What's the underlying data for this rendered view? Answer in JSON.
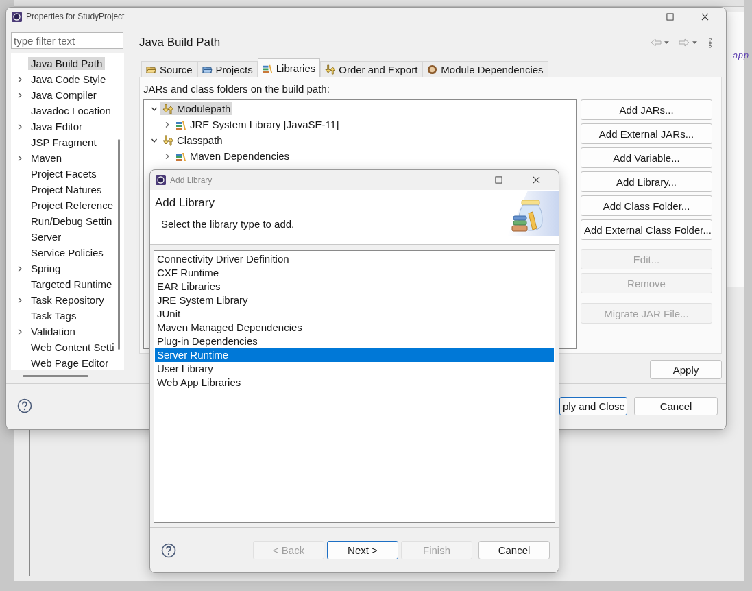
{
  "editor": {
    "code_fragment": "-app"
  },
  "properties": {
    "title": "Properties for StudyProject",
    "filter_placeholder": "type filter text",
    "categories": [
      {
        "label": "Java Build Path",
        "expandable": false,
        "selected": true
      },
      {
        "label": "Java Code Style",
        "expandable": true,
        "selected": false
      },
      {
        "label": "Java Compiler",
        "expandable": true,
        "selected": false
      },
      {
        "label": "Javadoc Location",
        "expandable": false,
        "selected": false
      },
      {
        "label": "Java Editor",
        "expandable": true,
        "selected": false
      },
      {
        "label": "JSP Fragment",
        "expandable": false,
        "selected": false
      },
      {
        "label": "Maven",
        "expandable": true,
        "selected": false
      },
      {
        "label": "Project Facets",
        "expandable": false,
        "selected": false
      },
      {
        "label": "Project Natures",
        "expandable": false,
        "selected": false
      },
      {
        "label": "Project Reference",
        "expandable": false,
        "selected": false
      },
      {
        "label": "Run/Debug Settin",
        "expandable": false,
        "selected": false
      },
      {
        "label": "Server",
        "expandable": false,
        "selected": false
      },
      {
        "label": "Service Policies",
        "expandable": false,
        "selected": false
      },
      {
        "label": "Spring",
        "expandable": true,
        "selected": false
      },
      {
        "label": "Targeted Runtime",
        "expandable": false,
        "selected": false
      },
      {
        "label": "Task Repository",
        "expandable": true,
        "selected": false
      },
      {
        "label": "Task Tags",
        "expandable": false,
        "selected": false
      },
      {
        "label": "Validation",
        "expandable": true,
        "selected": false
      },
      {
        "label": "Web Content Setti",
        "expandable": false,
        "selected": false
      },
      {
        "label": "Web Page Editor",
        "expandable": false,
        "selected": false
      }
    ],
    "page_title": "Java Build Path",
    "tabs": [
      {
        "label": "Source",
        "selected": false
      },
      {
        "label": "Projects",
        "selected": false
      },
      {
        "label": "Libraries",
        "selected": true
      },
      {
        "label": "Order and Export",
        "selected": false
      },
      {
        "label": "Module Dependencies",
        "selected": false
      }
    ],
    "entries_label": "JARs and class folders on the build path:",
    "entries": [
      {
        "label": "Modulepath",
        "kind": "container",
        "expanded": true,
        "selected": true,
        "children": [
          {
            "label": "JRE System Library [JavaSE-11]",
            "kind": "library",
            "expanded": false,
            "selected": false
          }
        ]
      },
      {
        "label": "Classpath",
        "kind": "container",
        "expanded": true,
        "selected": false,
        "children": [
          {
            "label": "Maven Dependencies",
            "kind": "library",
            "expanded": false,
            "selected": false
          }
        ]
      }
    ],
    "side_buttons": [
      {
        "label": "Add JARs...",
        "disabled": false
      },
      {
        "label": "Add External JARs...",
        "disabled": false
      },
      {
        "label": "Add Variable...",
        "disabled": false
      },
      {
        "label": "Add Library...",
        "disabled": false
      },
      {
        "label": "Add Class Folder...",
        "disabled": false
      },
      {
        "label": "Add External Class Folder...",
        "disabled": false
      },
      {
        "label": "Edit...",
        "disabled": true
      },
      {
        "label": "Remove",
        "disabled": true
      },
      {
        "label": "Migrate JAR File...",
        "disabled": true
      }
    ],
    "apply": "Apply",
    "footer_buttons": [
      {
        "label": "ply and Close",
        "default": true
      },
      {
        "label": "Cancel",
        "default": false
      }
    ]
  },
  "dialog": {
    "title": "Add Library",
    "heading": "Add Library",
    "description": "Select the library type to add.",
    "library_types": [
      {
        "label": "Connectivity Driver Definition",
        "selected": false
      },
      {
        "label": "CXF Runtime",
        "selected": false
      },
      {
        "label": "EAR Libraries",
        "selected": false
      },
      {
        "label": "JRE System Library",
        "selected": false
      },
      {
        "label": "JUnit",
        "selected": false
      },
      {
        "label": "Maven Managed Dependencies",
        "selected": false
      },
      {
        "label": "Plug-in Dependencies",
        "selected": false
      },
      {
        "label": "Server Runtime",
        "selected": true
      },
      {
        "label": "User Library",
        "selected": false
      },
      {
        "label": "Web App Libraries",
        "selected": false
      }
    ],
    "buttons": [
      {
        "label": "< Back",
        "disabled": true,
        "default": false
      },
      {
        "label": "Next >",
        "disabled": false,
        "default": true
      },
      {
        "label": "Finish",
        "disabled": true,
        "default": false
      },
      {
        "label": "Cancel",
        "disabled": false,
        "default": false
      }
    ]
  }
}
